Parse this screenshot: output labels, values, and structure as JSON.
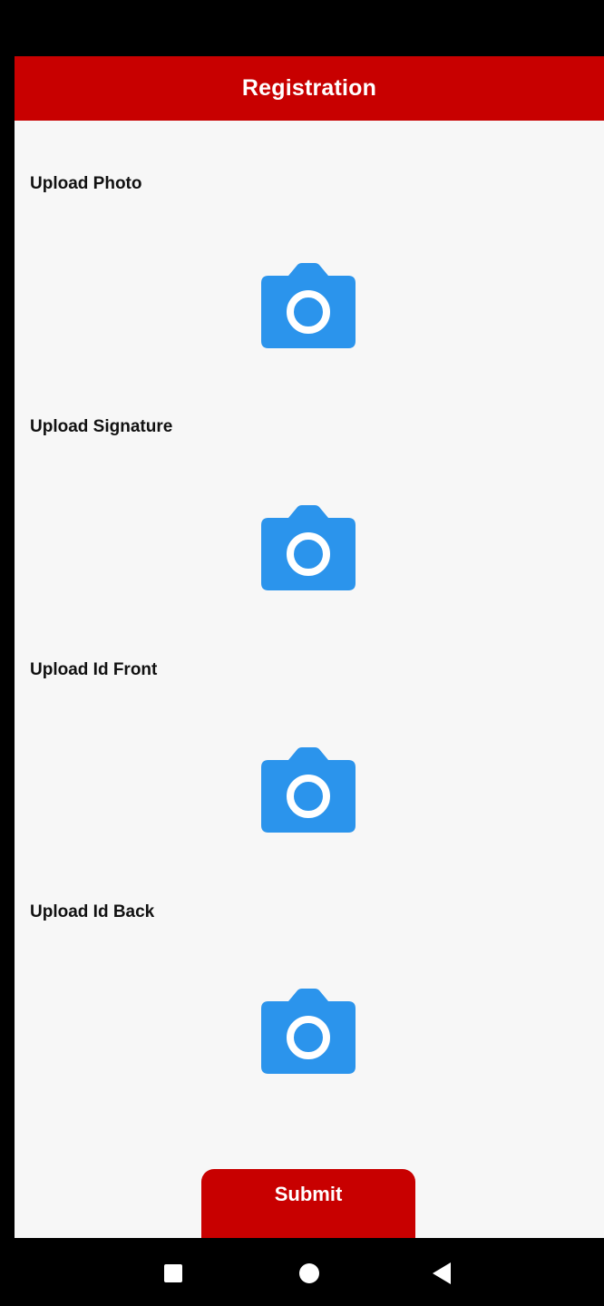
{
  "app_bar": {
    "title": "Registration"
  },
  "sections": [
    {
      "label": "Upload Photo",
      "icon": "camera-icon"
    },
    {
      "label": "Upload Signature",
      "icon": "camera-icon"
    },
    {
      "label": "Upload Id Front",
      "icon": "camera-icon"
    },
    {
      "label": "Upload Id Back",
      "icon": "camera-icon"
    }
  ],
  "submit": {
    "label": "Submit"
  },
  "nav_bar": {
    "items": [
      "recent-apps-icon",
      "home-icon",
      "back-icon"
    ]
  },
  "colors": {
    "brand": "#c80000",
    "icon": "#2b94ec",
    "background": "#f7f7f7"
  }
}
